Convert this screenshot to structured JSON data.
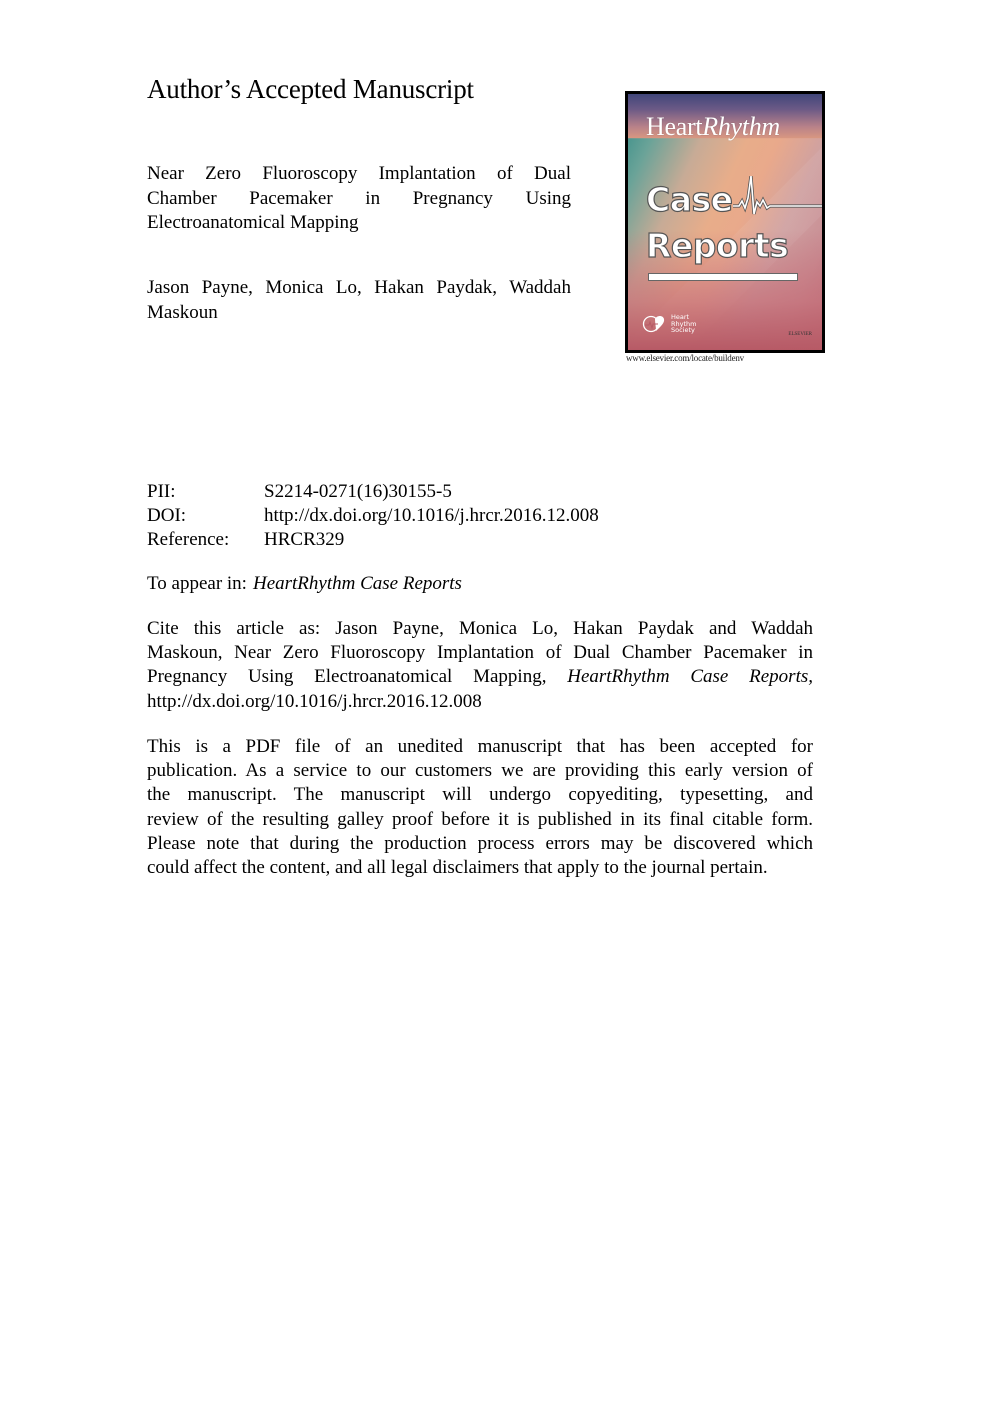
{
  "header": {
    "title": "Author’s Accepted Manuscript"
  },
  "article": {
    "title_lines": [
      "Near Zero Fluoroscopy Implantation of Dual",
      "Chamber Pacemaker in Pregnancy Using",
      "Electroanatomical Mapping"
    ],
    "author_lines": [
      "Jason Payne, Monica Lo, Hakan Paydak, Waddah",
      "Maskoun"
    ]
  },
  "cover": {
    "brand_regular": "Heart",
    "brand_italic": "Rhythm",
    "line1": "Case",
    "line2": "Reports",
    "society_lines": [
      "Heart",
      "Rhythm",
      "Society"
    ],
    "publisher_mark": "ELSEVIER",
    "url": "www.elsevier.com/locate/buildenv",
    "colors": {
      "top": "#41467a",
      "teal": "#2f8a86",
      "peach": "#e8ad8a",
      "bottom": "#b75a66"
    }
  },
  "metadata": {
    "pii_label": "PII:",
    "pii_value": "S2214-0271(16)30155-5",
    "doi_label": "DOI:",
    "doi_value": "http://dx.doi.org/10.1016/j.hrcr.2016.12.008",
    "reference_label": "Reference:",
    "reference_value": "HRCR329",
    "appear_label": "To appear in:",
    "appear_value": "HeartRhythm Case Reports"
  },
  "cite": {
    "lines": [
      "Cite this article as: Jason Payne, Monica Lo, Hakan Paydak and Waddah",
      "Maskoun, Near Zero Fluoroscopy Implantation of Dual Chamber Pacemaker in",
      "Pregnancy Using Electroanatomical Mapping,",
      "http://dx.doi.org/10.1016/j.hrcr.2016.12.008"
    ],
    "journal_italic": "HeartRhythm Case Reports,"
  },
  "disclaimer": {
    "lines": [
      "This is a PDF file of an unedited manuscript that has been accepted for",
      "publication. As a service to our customers we are providing this early version of",
      "the manuscript. The manuscript will undergo copyediting, typesetting, and",
      "review of the resulting galley proof before it is published in its final citable form.",
      "Please note that during the production process errors may be discovered which",
      "could affect the content, and all legal disclaimers that apply to the journal pertain."
    ]
  }
}
